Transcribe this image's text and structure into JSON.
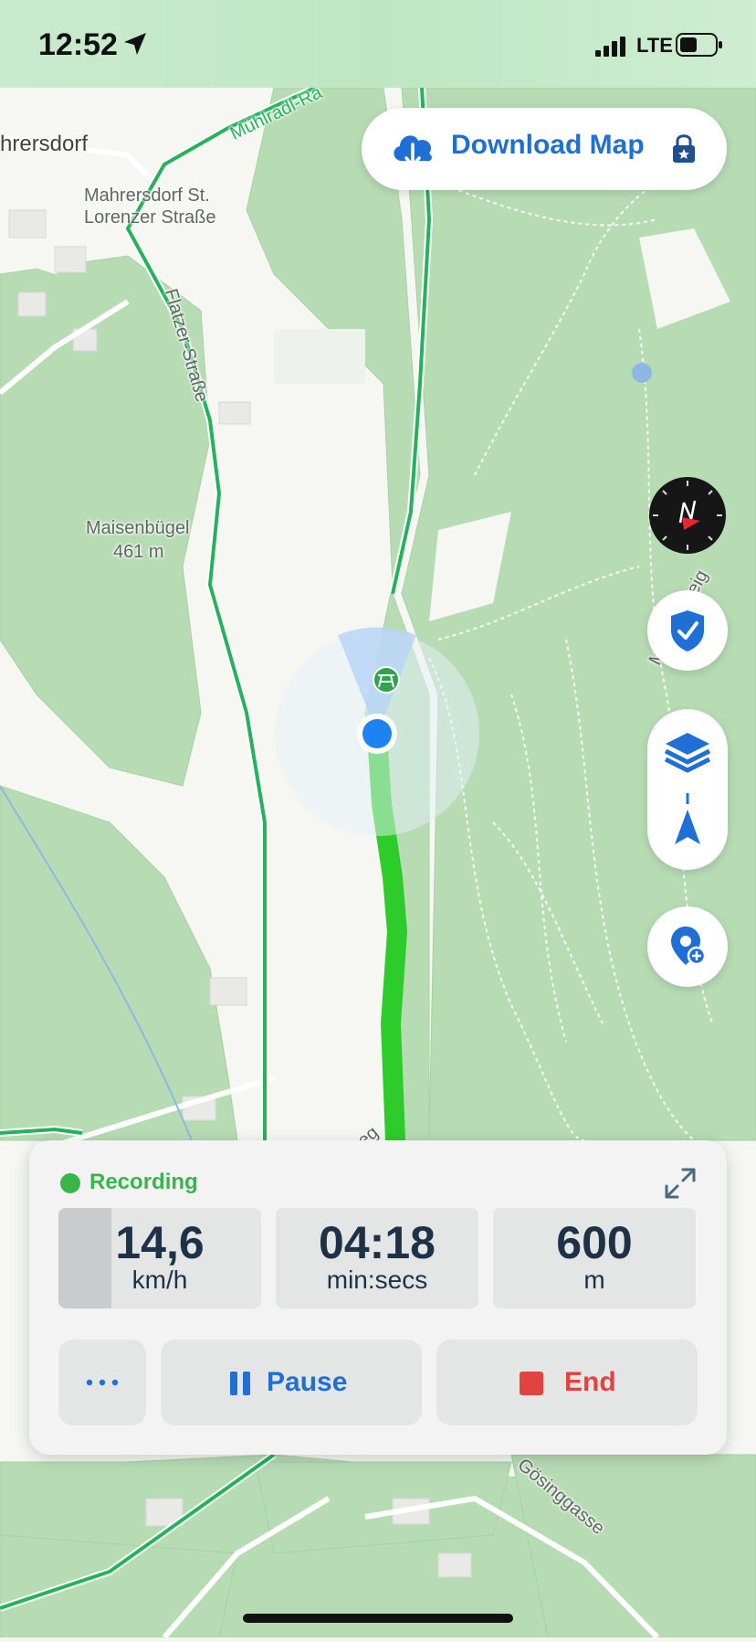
{
  "status_bar": {
    "time": "12:52",
    "network": "LTE"
  },
  "map": {
    "labels": {
      "village": "hrersdorf",
      "street_stop": "Mahrersdorf St.",
      "street_stop_2": "Lorenzer Straße",
      "road_1": "Mühlradl-Ra",
      "road_2": "Flatzer-Straße",
      "hill": "Maisenbügel",
      "hill_elevation": "461 m",
      "path_right": "Mu        steig",
      "path_bottom": "eg",
      "street_bottom": "Gösinggasse"
    },
    "colors": {
      "forest": "#b4dbb2",
      "track": "#2ecc2a",
      "road": "#24b35a",
      "location": "#1e82f0"
    }
  },
  "download_map": {
    "label": "Download Map",
    "icon": "cloud-download-icon",
    "lock_icon": "lock-star-icon"
  },
  "controls": {
    "compass": "compass-icon",
    "security": "shield-check-icon",
    "layers": "layers-icon",
    "navigate": "navigation-arrow-icon",
    "add_pin": "add-pin-icon"
  },
  "recording": {
    "status": "Recording",
    "stats": {
      "speed": {
        "value": "14,6",
        "unit": "km/h",
        "fill_fraction": 0.26
      },
      "time": {
        "value": "04:18",
        "unit": "min:secs"
      },
      "distance": {
        "value": "600",
        "unit": "m"
      }
    },
    "more_label": "···",
    "pause_label": "Pause",
    "end_label": "End",
    "accent": "#1f6fd6",
    "end_color": "#e24242"
  }
}
